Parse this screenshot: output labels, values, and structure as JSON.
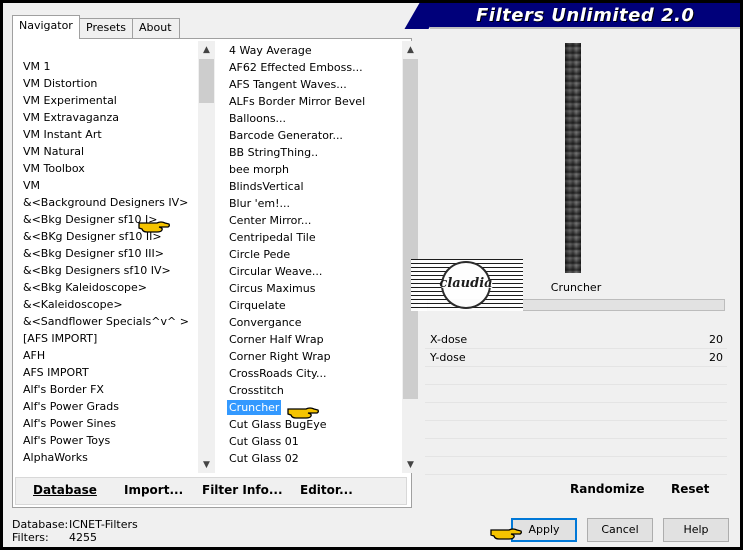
{
  "header": {
    "title": "Filters Unlimited 2.0"
  },
  "tabs": [
    {
      "label": "Navigator"
    },
    {
      "label": "Presets"
    },
    {
      "label": "About"
    }
  ],
  "categories": {
    "items": [
      "VM 1",
      "VM Distortion",
      "VM Experimental",
      "VM Extravaganza",
      "VM Instant Art",
      "VM Natural",
      "VM Toolbox",
      "VM",
      "&<Background Designers IV>",
      "&<Bkg Designer sf10 I>",
      "&<BKg Designer sf10 II>",
      "&<Bkg Designer sf10 III>",
      "&<Bkg Designers sf10 IV>",
      "&<Bkg Kaleidoscope>",
      "&<Kaleidoscope>",
      "&<Sandflower Specials^v^ >",
      "[AFS IMPORT]",
      "AFH",
      "AFS IMPORT",
      "Alf's Border FX",
      "Alf's Power Grads",
      "Alf's Power Sines",
      "Alf's Power Toys",
      "AlphaWorks"
    ]
  },
  "filters": {
    "items": [
      "4 Way Average",
      "AF62 Effected Emboss...",
      "AFS Tangent Waves...",
      "ALFs Border Mirror Bevel",
      "Balloons...",
      "Barcode Generator...",
      "BB StringThing..",
      "bee morph",
      "BlindsVertical",
      "Blur 'em!...",
      "Center Mirror...",
      "Centripedal Tile",
      "Circle Pede",
      "Circular Weave...",
      "Circus Maximus",
      "Cirquelate",
      "Convergance",
      "Corner Half Wrap",
      "Corner Right Wrap",
      "CrossRoads City...",
      "Crosstitch",
      "Cruncher",
      "Cut Glass  BugEye",
      "Cut Glass 01",
      "Cut Glass 02"
    ],
    "selected": "Cruncher"
  },
  "left_buttons": {
    "database": "Database",
    "import": "Import...",
    "filter_info": "Filter Info...",
    "editor": "Editor..."
  },
  "preview": {
    "filter_name": "Cruncher",
    "watermark": "claudia"
  },
  "params": [
    {
      "name": "X-dose",
      "value": "20"
    },
    {
      "name": "Y-dose",
      "value": "20"
    }
  ],
  "right_buttons": {
    "randomize": "Randomize",
    "reset": "Reset"
  },
  "status": {
    "database_label": "Database:",
    "database_value": "ICNET-Filters",
    "filters_label": "Filters:",
    "filters_value": "4255"
  },
  "dialog_buttons": {
    "apply": "Apply",
    "cancel": "Cancel",
    "help": "Help"
  },
  "colors": {
    "selection": "#3399ff",
    "banner": "#00007a",
    "hand_pointer": "#f5c400"
  }
}
